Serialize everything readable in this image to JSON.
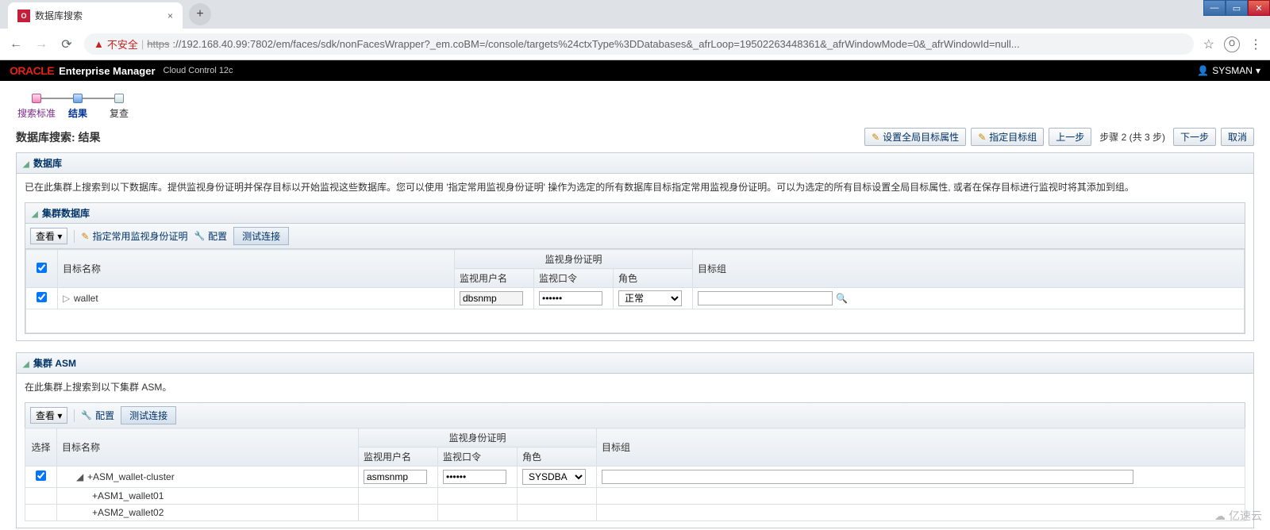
{
  "browser": {
    "tab_title": "数据库搜索",
    "insecure_label": "不安全",
    "url_prefix": "https",
    "url_rest": "://192.168.40.99:7802/em/faces/sdk/nonFacesWrapper?_em.coBM=/console/targets%24ctxType%3DDatabases&_afrLoop=19502263448361&_afrWindowMode=0&_afrWindowId=null..."
  },
  "app": {
    "logo": "ORACLE",
    "name": "Enterprise Manager",
    "sub": "Cloud Control 12c",
    "user": "SYSMAN"
  },
  "train": {
    "step1": "搜索标准",
    "step2": "结果",
    "step3": "复查"
  },
  "page": {
    "title": "数据库搜索: 结果",
    "btn_global_attr": "设置全局目标属性",
    "btn_assign_group": "指定目标组",
    "btn_prev": "上一步",
    "step_text": "步骤 2 (共 3 步)",
    "btn_next": "下一步",
    "btn_cancel": "取消"
  },
  "db_panel": {
    "title": "数据库",
    "desc": "已在此集群上搜索到以下数据库。提供监视身份证明并保存目标以开始监视这些数据库。您可以使用 '指定常用监视身份证明' 操作为选定的所有数据库目标指定常用监视身份证明。可以为选定的所有目标设置全局目标属性, 或者在保存目标进行监视时将其添加到组。",
    "sub_title": "集群数据库",
    "view": "查看",
    "link_cred": "指定常用监视身份证明",
    "link_conf": "配置",
    "btn_test": "测试连接",
    "col_target": "目标名称",
    "col_cred_group": "监视身份证明",
    "col_user": "监视用户名",
    "col_pwd": "监视口令",
    "col_role": "角色",
    "col_group": "目标组",
    "row": {
      "name": "wallet",
      "user": "dbsnmp",
      "pwd": "••••••",
      "role": "正常"
    }
  },
  "asm_panel": {
    "title": "集群 ASM",
    "desc": "在此集群上搜索到以下集群 ASM。",
    "view": "查看",
    "link_conf": "配置",
    "btn_test": "测试连接",
    "col_select": "选择",
    "col_target": "目标名称",
    "col_cred_group": "监视身份证明",
    "col_user": "监视用户名",
    "col_pwd": "监视口令",
    "col_role": "角色",
    "col_group": "目标组",
    "row0": {
      "name": "+ASM_wallet-cluster",
      "user": "asmsnmp",
      "pwd": "••••••",
      "role": "SYSDBA"
    },
    "row1": {
      "name": "+ASM1_wallet01"
    },
    "row2": {
      "name": "+ASM2_wallet02"
    }
  },
  "watermark": "亿速云"
}
